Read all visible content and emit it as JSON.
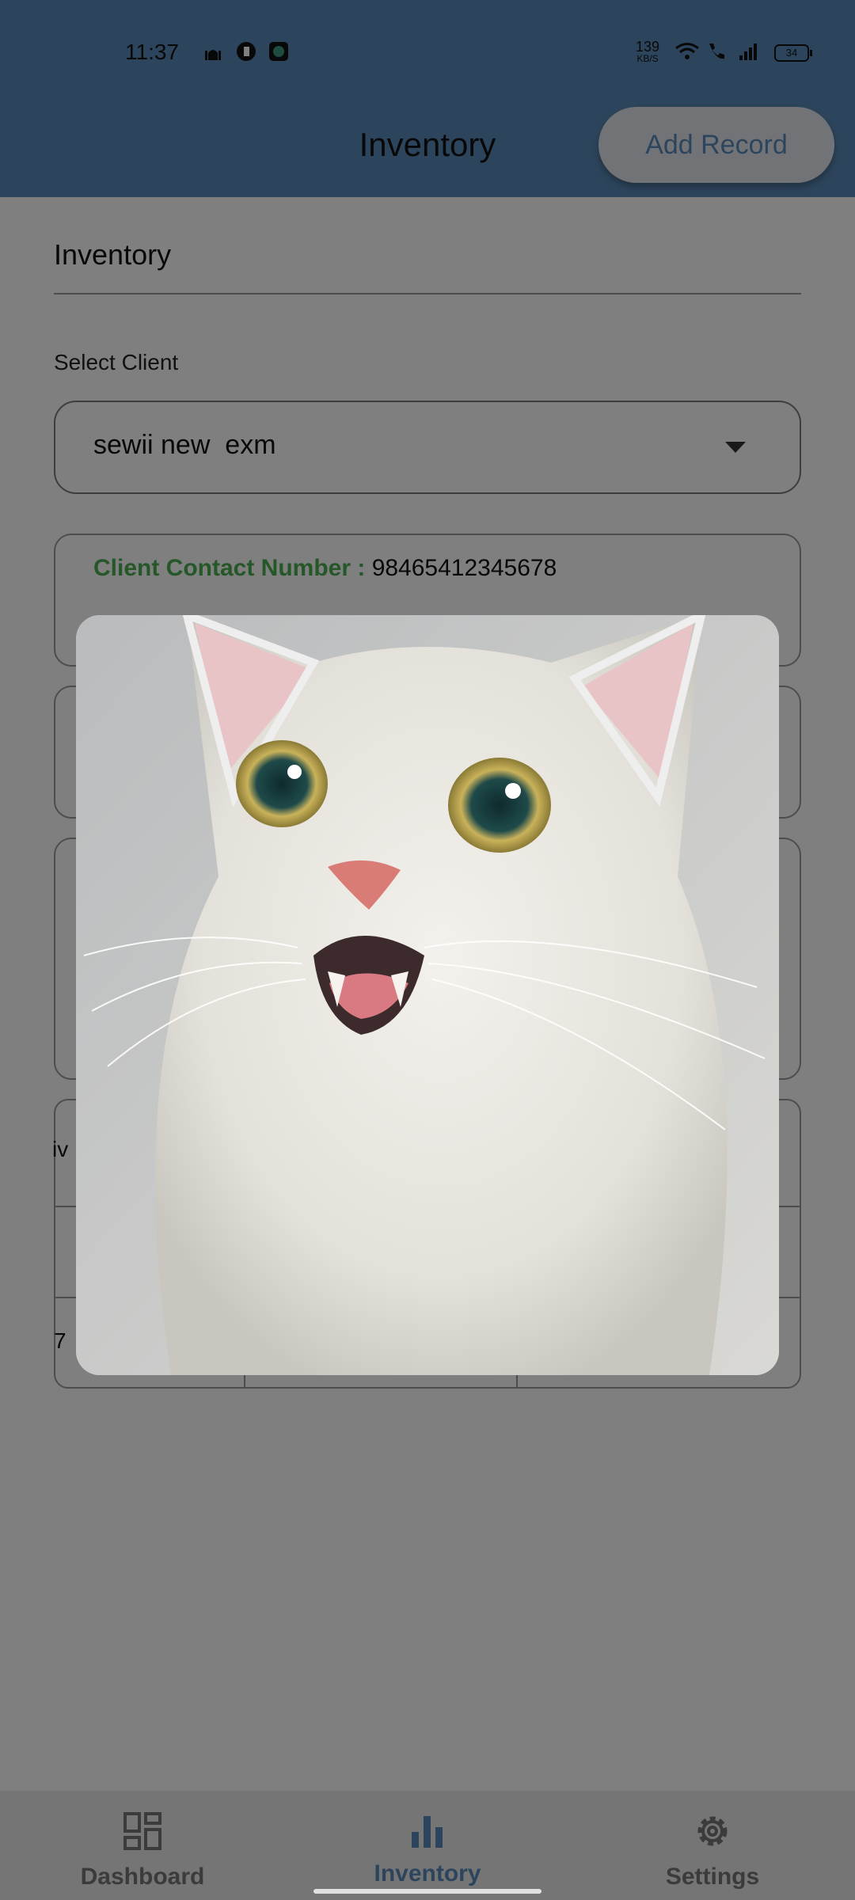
{
  "status_bar": {
    "time": "11:37",
    "speed_value": "139",
    "speed_unit": "KB/S",
    "battery": "34",
    "icons": [
      "mosque-icon",
      "vpn-icon",
      "shield-app-icon",
      "wifi-icon",
      "wifi-call-icon",
      "signal-icon",
      "battery-icon"
    ]
  },
  "app_bar": {
    "title": "Inventory",
    "add_record_label": "Add Record"
  },
  "page": {
    "section_title": "Inventory",
    "select_client_label": "Select Client",
    "selected_client": "sewii new  exm",
    "contact_label": "Client Contact Number : ",
    "contact_value": "98465412345678",
    "row_fragment_1": "iv",
    "row_fragment_2": "7"
  },
  "dialog": {
    "image": "kitten-photo"
  },
  "bottom_nav": {
    "items": [
      {
        "label": "Dashboard",
        "icon": "dashboard-icon"
      },
      {
        "label": "Inventory",
        "icon": "bar-chart-icon"
      },
      {
        "label": "Settings",
        "icon": "gear-icon"
      }
    ],
    "active_index": 1
  },
  "colors": {
    "app_bar": "#5b8bb9",
    "accent": "#5b8bb9",
    "contact_label": "#4caf50",
    "nav_inactive": "#777777"
  }
}
